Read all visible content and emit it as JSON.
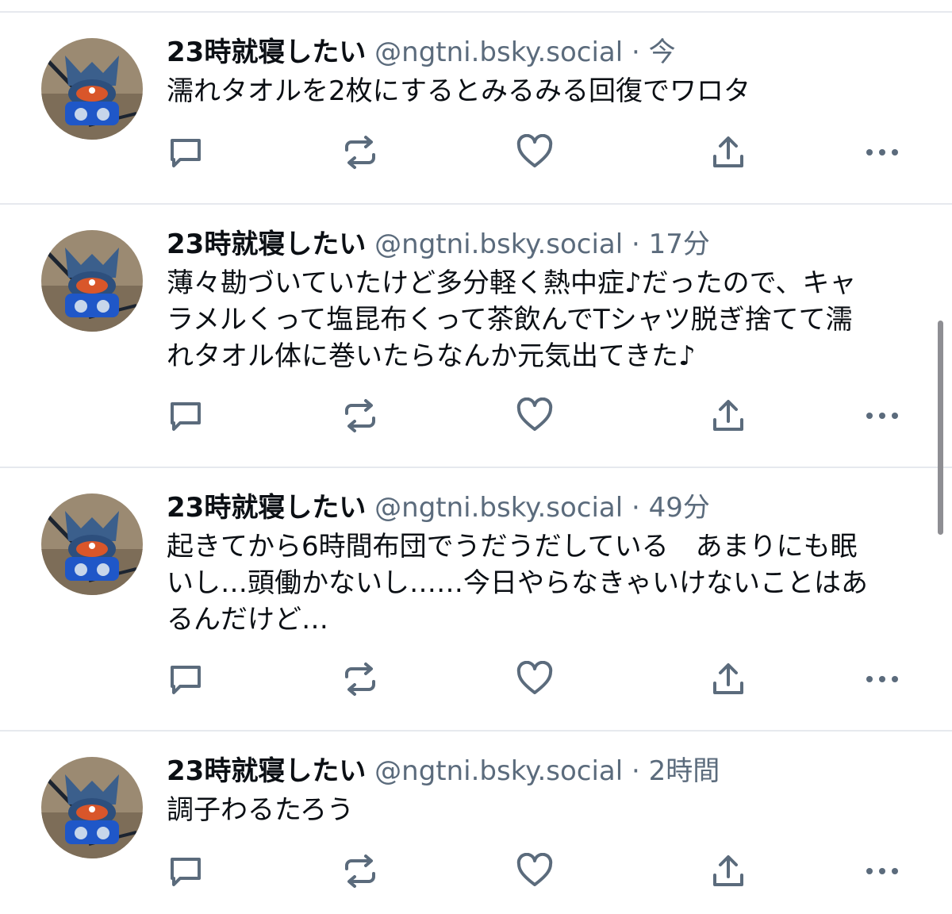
{
  "posts": [
    {
      "name": "23時就寝したい",
      "handle": "@ngtni.bsky.social",
      "sep": "·",
      "time": "今",
      "lines": [
        "濡れタオルを2枚にするとみるみる回復でワロタ"
      ]
    },
    {
      "name": "23時就寝したい",
      "handle": "@ngtni.bsky.social",
      "sep": "·",
      "time": "17分",
      "lines": [
        "薄々勘づいていたけど多分軽く熱中症♪だったので、キャ",
        "ラメルくって塩昆布くって茶飲んでTシャツ脱ぎ捨てて濡",
        "れタオル体に巻いたらなんか元気出てきた♪"
      ]
    },
    {
      "name": "23時就寝したい",
      "handle": "@ngtni.bsky.social",
      "sep": "·",
      "time": "49分",
      "lines": [
        "起きてから6時間布団でうだうだしている　あまりにも眠",
        "いし…頭働かないし……今日やらなきゃいけないことはあ",
        "るんだけど…"
      ]
    },
    {
      "name": "23時就寝したい",
      "handle": "@ngtni.bsky.social",
      "sep": "·",
      "time": "2時間",
      "lines": [
        "調子わるたろう"
      ]
    }
  ],
  "icons": {
    "reply": "reply-icon",
    "repost": "repost-icon",
    "like": "heart-icon",
    "share": "share-icon",
    "more": "more-icon"
  },
  "colors": {
    "icon": "#5b6b7c",
    "muted": "#5b6b7c",
    "divider": "#e6e9ee"
  }
}
